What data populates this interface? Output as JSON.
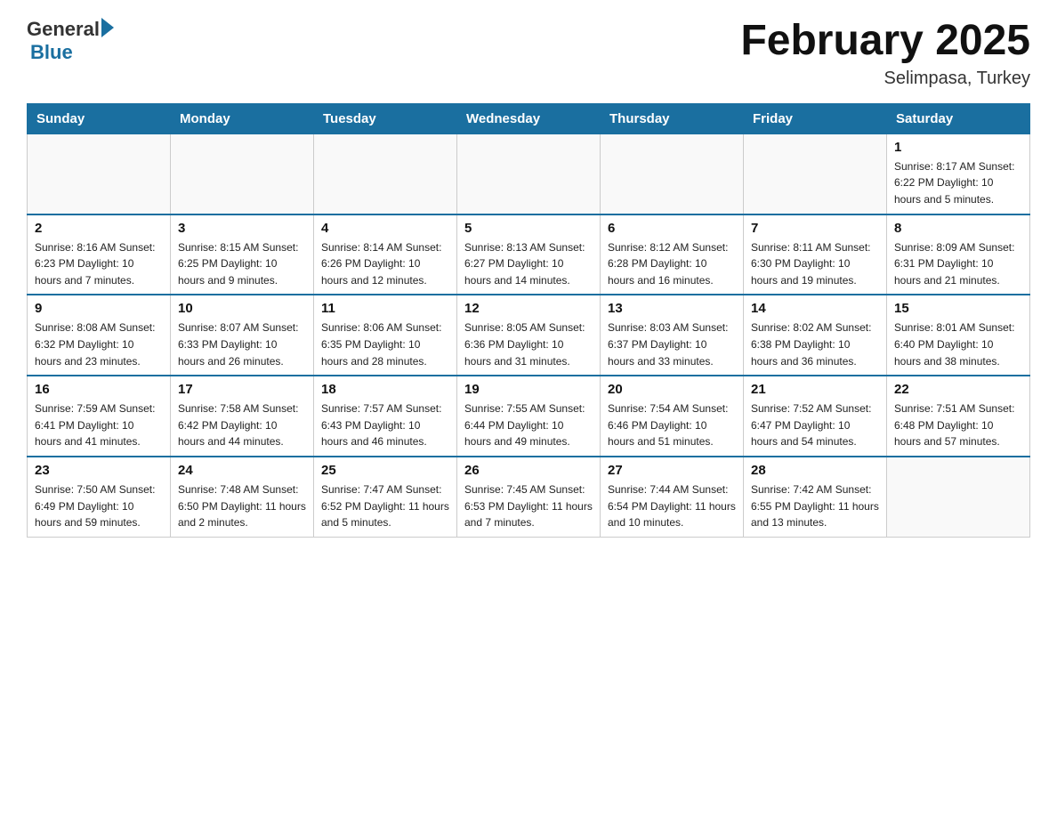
{
  "header": {
    "logo_general": "General",
    "logo_blue": "Blue",
    "title": "February 2025",
    "subtitle": "Selimpasa, Turkey"
  },
  "weekdays": [
    "Sunday",
    "Monday",
    "Tuesday",
    "Wednesday",
    "Thursday",
    "Friday",
    "Saturday"
  ],
  "weeks": [
    [
      {
        "day": "",
        "info": ""
      },
      {
        "day": "",
        "info": ""
      },
      {
        "day": "",
        "info": ""
      },
      {
        "day": "",
        "info": ""
      },
      {
        "day": "",
        "info": ""
      },
      {
        "day": "",
        "info": ""
      },
      {
        "day": "1",
        "info": "Sunrise: 8:17 AM\nSunset: 6:22 PM\nDaylight: 10 hours and 5 minutes."
      }
    ],
    [
      {
        "day": "2",
        "info": "Sunrise: 8:16 AM\nSunset: 6:23 PM\nDaylight: 10 hours and 7 minutes."
      },
      {
        "day": "3",
        "info": "Sunrise: 8:15 AM\nSunset: 6:25 PM\nDaylight: 10 hours and 9 minutes."
      },
      {
        "day": "4",
        "info": "Sunrise: 8:14 AM\nSunset: 6:26 PM\nDaylight: 10 hours and 12 minutes."
      },
      {
        "day": "5",
        "info": "Sunrise: 8:13 AM\nSunset: 6:27 PM\nDaylight: 10 hours and 14 minutes."
      },
      {
        "day": "6",
        "info": "Sunrise: 8:12 AM\nSunset: 6:28 PM\nDaylight: 10 hours and 16 minutes."
      },
      {
        "day": "7",
        "info": "Sunrise: 8:11 AM\nSunset: 6:30 PM\nDaylight: 10 hours and 19 minutes."
      },
      {
        "day": "8",
        "info": "Sunrise: 8:09 AM\nSunset: 6:31 PM\nDaylight: 10 hours and 21 minutes."
      }
    ],
    [
      {
        "day": "9",
        "info": "Sunrise: 8:08 AM\nSunset: 6:32 PM\nDaylight: 10 hours and 23 minutes."
      },
      {
        "day": "10",
        "info": "Sunrise: 8:07 AM\nSunset: 6:33 PM\nDaylight: 10 hours and 26 minutes."
      },
      {
        "day": "11",
        "info": "Sunrise: 8:06 AM\nSunset: 6:35 PM\nDaylight: 10 hours and 28 minutes."
      },
      {
        "day": "12",
        "info": "Sunrise: 8:05 AM\nSunset: 6:36 PM\nDaylight: 10 hours and 31 minutes."
      },
      {
        "day": "13",
        "info": "Sunrise: 8:03 AM\nSunset: 6:37 PM\nDaylight: 10 hours and 33 minutes."
      },
      {
        "day": "14",
        "info": "Sunrise: 8:02 AM\nSunset: 6:38 PM\nDaylight: 10 hours and 36 minutes."
      },
      {
        "day": "15",
        "info": "Sunrise: 8:01 AM\nSunset: 6:40 PM\nDaylight: 10 hours and 38 minutes."
      }
    ],
    [
      {
        "day": "16",
        "info": "Sunrise: 7:59 AM\nSunset: 6:41 PM\nDaylight: 10 hours and 41 minutes."
      },
      {
        "day": "17",
        "info": "Sunrise: 7:58 AM\nSunset: 6:42 PM\nDaylight: 10 hours and 44 minutes."
      },
      {
        "day": "18",
        "info": "Sunrise: 7:57 AM\nSunset: 6:43 PM\nDaylight: 10 hours and 46 minutes."
      },
      {
        "day": "19",
        "info": "Sunrise: 7:55 AM\nSunset: 6:44 PM\nDaylight: 10 hours and 49 minutes."
      },
      {
        "day": "20",
        "info": "Sunrise: 7:54 AM\nSunset: 6:46 PM\nDaylight: 10 hours and 51 minutes."
      },
      {
        "day": "21",
        "info": "Sunrise: 7:52 AM\nSunset: 6:47 PM\nDaylight: 10 hours and 54 minutes."
      },
      {
        "day": "22",
        "info": "Sunrise: 7:51 AM\nSunset: 6:48 PM\nDaylight: 10 hours and 57 minutes."
      }
    ],
    [
      {
        "day": "23",
        "info": "Sunrise: 7:50 AM\nSunset: 6:49 PM\nDaylight: 10 hours and 59 minutes."
      },
      {
        "day": "24",
        "info": "Sunrise: 7:48 AM\nSunset: 6:50 PM\nDaylight: 11 hours and 2 minutes."
      },
      {
        "day": "25",
        "info": "Sunrise: 7:47 AM\nSunset: 6:52 PM\nDaylight: 11 hours and 5 minutes."
      },
      {
        "day": "26",
        "info": "Sunrise: 7:45 AM\nSunset: 6:53 PM\nDaylight: 11 hours and 7 minutes."
      },
      {
        "day": "27",
        "info": "Sunrise: 7:44 AM\nSunset: 6:54 PM\nDaylight: 11 hours and 10 minutes."
      },
      {
        "day": "28",
        "info": "Sunrise: 7:42 AM\nSunset: 6:55 PM\nDaylight: 11 hours and 13 minutes."
      },
      {
        "day": "",
        "info": ""
      }
    ]
  ]
}
